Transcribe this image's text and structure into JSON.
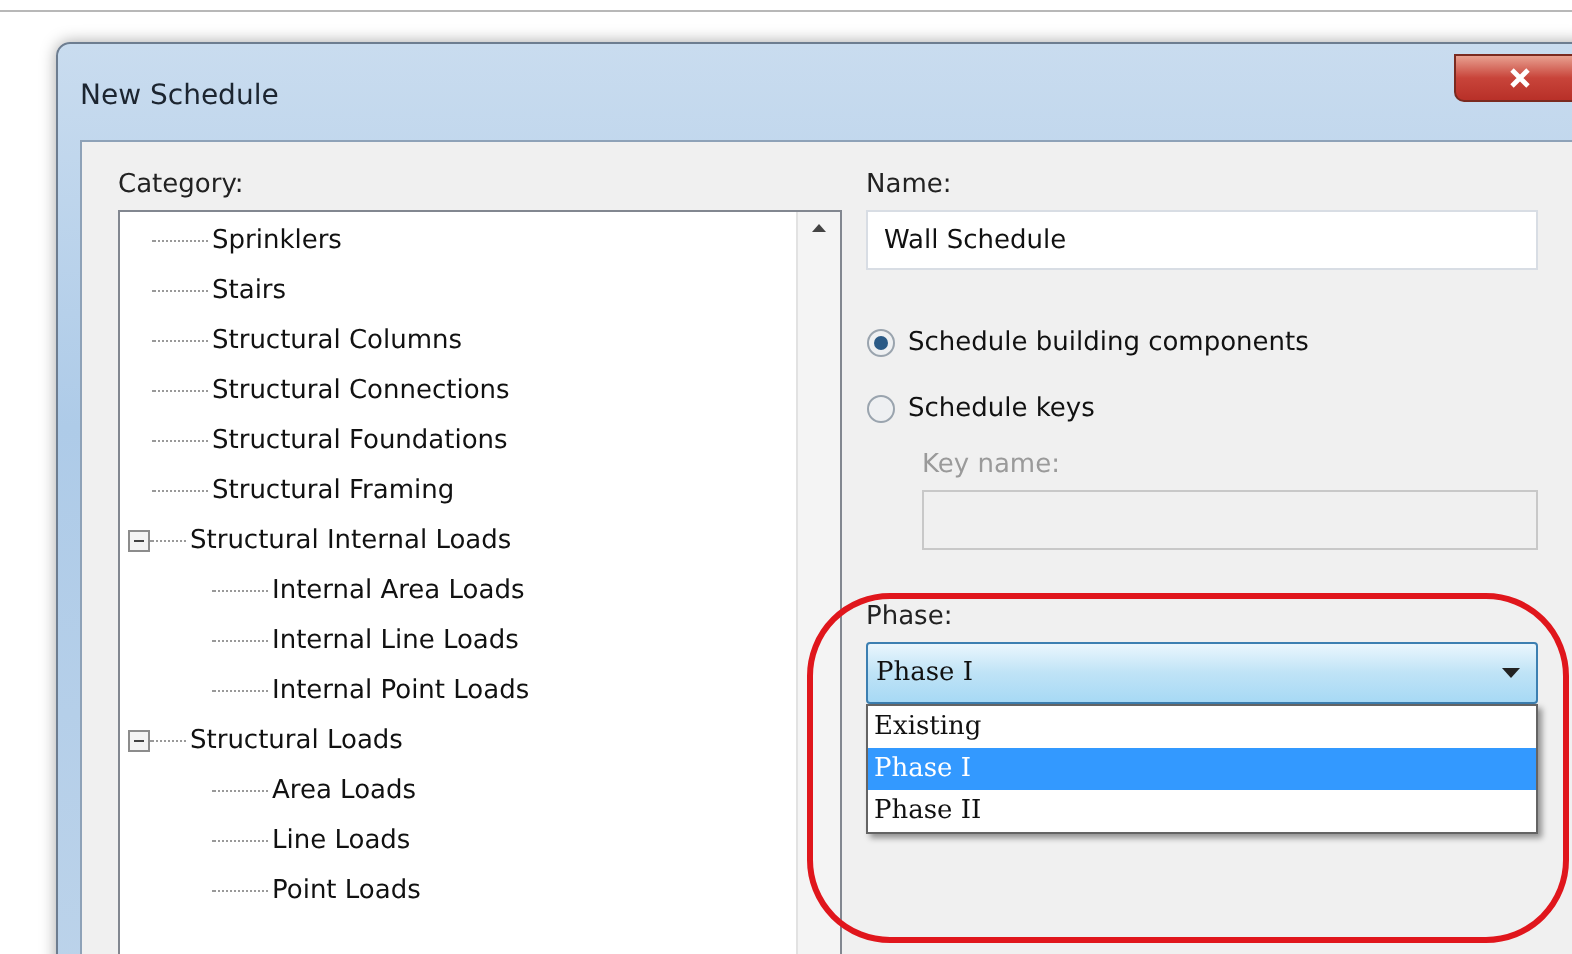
{
  "window": {
    "title": "New Schedule"
  },
  "category": {
    "label": "Category:",
    "tree": [
      {
        "label": "Sprinklers"
      },
      {
        "label": "Stairs"
      },
      {
        "label": "Structural Columns"
      },
      {
        "label": "Structural Connections"
      },
      {
        "label": "Structural Foundations"
      },
      {
        "label": "Structural Framing"
      },
      {
        "label": "Structural Internal Loads",
        "expanded": true,
        "children": [
          {
            "label": "Internal Area Loads"
          },
          {
            "label": "Internal Line Loads"
          },
          {
            "label": "Internal Point Loads"
          }
        ]
      },
      {
        "label": "Structural Loads",
        "expanded": true,
        "children": [
          {
            "label": "Area Loads"
          },
          {
            "label": "Line Loads"
          },
          {
            "label": "Point Loads"
          }
        ]
      }
    ]
  },
  "name": {
    "label": "Name:",
    "value": "Wall Schedule"
  },
  "schedule_type": [
    {
      "label": "Schedule building components",
      "selected": true
    },
    {
      "label": "Schedule keys",
      "selected": false
    }
  ],
  "key_name": {
    "label": "Key name:",
    "disabled": true
  },
  "phase": {
    "label": "Phase:",
    "value": "Phase I",
    "options": [
      {
        "label": "Existing",
        "selected": false
      },
      {
        "label": "Phase I",
        "selected": true
      },
      {
        "label": "Phase II",
        "selected": false
      }
    ]
  }
}
